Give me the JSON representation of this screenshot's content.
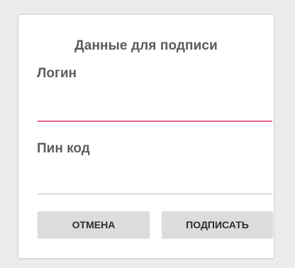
{
  "dialog": {
    "title": "Данные для подписи",
    "login": {
      "label": "Логин",
      "value": "",
      "focused": true
    },
    "pin": {
      "label": "Пин код",
      "value": ""
    },
    "buttons": {
      "cancel_label": "ОТМЕНА",
      "sign_label": "ПОДПИСАТЬ"
    }
  },
  "colors": {
    "accent_underline": "#e8609a",
    "button_bg": "#dcdcdc"
  }
}
